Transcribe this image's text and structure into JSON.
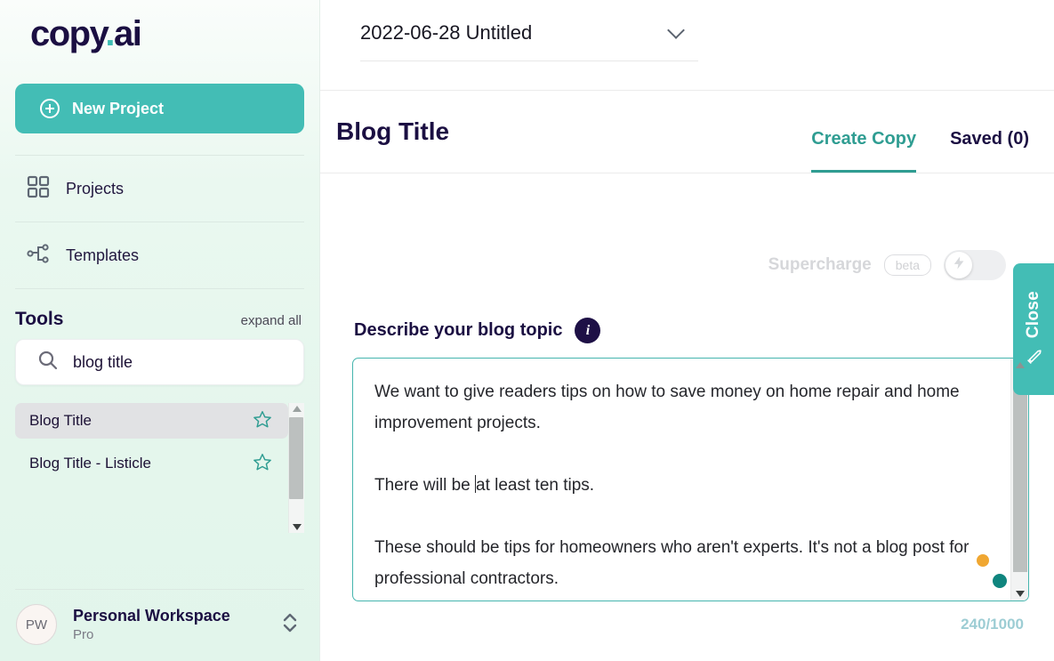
{
  "brand": {
    "name": "copy",
    "dot": ".",
    "suffix": "ai"
  },
  "sidebar": {
    "new_project_label": "New Project",
    "nav": [
      {
        "label": "Projects",
        "icon": "grid-icon"
      },
      {
        "label": "Templates",
        "icon": "node-tree-icon"
      }
    ],
    "tools_heading": "Tools",
    "expand_all_label": "expand all",
    "search": {
      "value": "blog title",
      "placeholder": "Search tools",
      "icon": "search-icon"
    },
    "tool_items": [
      {
        "label": "Blog Title",
        "selected": true,
        "favorite_icon": "star-icon"
      },
      {
        "label": "Blog Title - Listicle",
        "selected": false,
        "favorite_icon": "star-icon"
      }
    ],
    "workspace": {
      "initials": "PW",
      "name": "Personal Workspace",
      "plan": "Pro",
      "switch_icon": "chevron-up-down-icon"
    }
  },
  "header": {
    "project_title": "2022-06-28 Untitled",
    "project_dropdown_icon": "chevron-down-icon",
    "page_title": "Blog Title",
    "tabs": [
      {
        "label": "Create Copy",
        "active": true
      },
      {
        "label": "Saved (0)",
        "active": false
      }
    ]
  },
  "main": {
    "supercharge": {
      "label": "Supercharge",
      "badge": "beta",
      "toggle_icon": "lightning-bolt-icon",
      "enabled": false
    },
    "field": {
      "label": "Describe your blog topic",
      "info_icon": "info-icon",
      "value_before_caret": "We want to give readers tips on how to save money on home repair and home improvement projects.\n\nThere will be ",
      "value_after_caret": "at least ten tips.\n\nThese should be tips for homeowners who aren't experts. It's not a blog post for professional contractors.",
      "counter": "240/1000"
    },
    "close_tab": {
      "label": "Close",
      "icon": "pencil-icon"
    }
  },
  "colors": {
    "accent_teal": "#43bdb5",
    "tab_teal": "#2f9d92",
    "navy": "#1b0f42",
    "sidebar_mint": "#e4f6ec",
    "orange_dot": "#f0a732",
    "teal_dot": "#0f857e"
  }
}
